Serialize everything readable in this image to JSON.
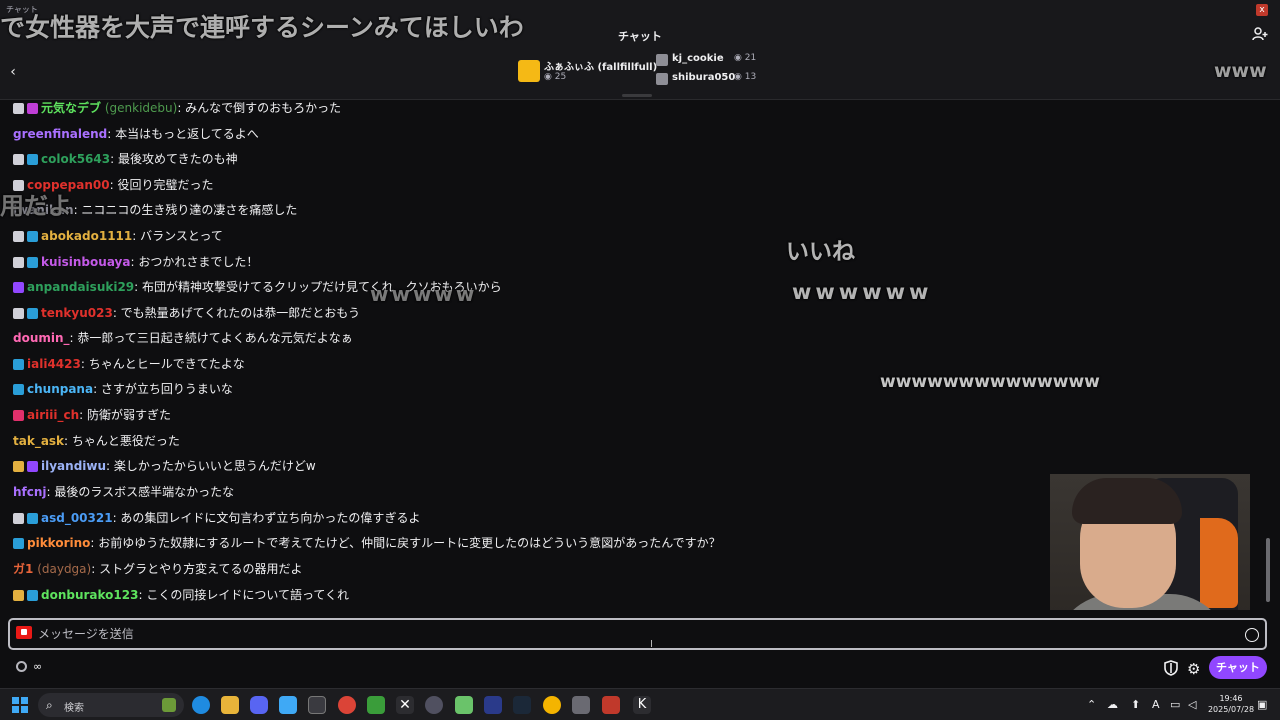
{
  "window": {
    "title": "チャット",
    "close_label": "x"
  },
  "header": {
    "title": "チャット",
    "host": {
      "name": "ふぁふぃふ (fallfillfull)",
      "views": "25"
    },
    "guests": [
      {
        "name": "kj_cookie",
        "views": "21"
      },
      {
        "name": "shibura050",
        "views": "13"
      }
    ]
  },
  "overlay_comments": {
    "top": "で女性器を大声で連呼するシーンみてほしいわ",
    "w1": "www",
    "yo": "用だよ",
    "iine": "いいね",
    "w2": "wwwwww",
    "w3": "wwwww",
    "w4": "wwwwwwwwwwwwww"
  },
  "messages": [
    {
      "user": "元気なデブ",
      "handle": "(genkidebu)",
      "text": ": みんなで倒すのおもろかった",
      "color": "#5ee35e",
      "badges": [
        "b-sub",
        "b-gift"
      ]
    },
    {
      "user": "greenfinalend",
      "handle": "",
      "text": ": 本当はもっと返してるよへ",
      "color": "#a970ff",
      "badges": []
    },
    {
      "user": "colok5643",
      "handle": "",
      "text": ": 最後攻めてきたのも神",
      "color": "#2ea05c",
      "badges": [
        "b-sub",
        "b-prime"
      ]
    },
    {
      "user": "coppepan00",
      "handle": "",
      "text": ": 役回り完璧だった",
      "color": "#e0312c",
      "badges": [
        "b-sub"
      ]
    },
    {
      "user": "iwanikan",
      "handle": "",
      "text": ": ニコニコの生き残り達の凄さを痛感した",
      "color": "#8c8c96",
      "badges": []
    },
    {
      "user": "abokado1111",
      "handle": "",
      "text": ": バランスとって",
      "color": "#e3b040",
      "badges": [
        "b-sub",
        "b-prime"
      ]
    },
    {
      "user": "kuisinbouaya",
      "handle": "",
      "text": ": おつかれさまでした！",
      "color": "#c45ae8",
      "badges": [
        "b-sub",
        "b-prime"
      ]
    },
    {
      "user": "anpandaisuki29",
      "handle": "",
      "text": ": 布団が精神攻撃受けてるクリップだけ見てくれ　クソおもろいから",
      "color": "#2ea05c",
      "badges": [
        "b-partner"
      ]
    },
    {
      "user": "tenkyu023",
      "handle": "",
      "text": ": でも熱量あげてくれたのは恭一郎だとおもう",
      "color": "#e0312c",
      "badges": [
        "b-sub",
        "b-prime"
      ]
    },
    {
      "user": "doumin_",
      "handle": "",
      "text": ": 恭一郎って三日起き続けてよくあんな元気だよなぁ",
      "color": "#ff69b4",
      "badges": []
    },
    {
      "user": "iali4423",
      "handle": "",
      "text": ": ちゃんとヒールできてたよな",
      "color": "#e0312c",
      "badges": [
        "b-prime"
      ]
    },
    {
      "user": "chunpana",
      "handle": "",
      "text": ": さすが立ち回りうまいな",
      "color": "#4bb5f5",
      "badges": [
        "b-prime"
      ]
    },
    {
      "user": "airiii_ch",
      "handle": "",
      "text": ": 防衛が弱すぎた",
      "color": "#e0312c",
      "badges": [
        "b-pink"
      ]
    },
    {
      "user": "tak_ask",
      "handle": "",
      "text": ": ちゃんと悪役だった",
      "color": "#e3b040",
      "badges": []
    },
    {
      "user": "ilyandiwu",
      "handle": "",
      "text": ": 楽しかったからいいと思うんだけどw",
      "color": "#9bb2f5",
      "badges": [
        "b-gold",
        "b-partner"
      ]
    },
    {
      "user": "hfcnj",
      "handle": "",
      "text": ": 最後のラスボス感半端なかったな",
      "color": "#a970ff",
      "badges": []
    },
    {
      "user": "asd_00321",
      "handle": "",
      "text": ": あの集団レイドに文句言わず立ち向かったの偉すぎるよ",
      "color": "#4b9cf5",
      "badges": [
        "b-sub",
        "b-prime"
      ]
    },
    {
      "user": "pikkorino",
      "handle": "",
      "text": ": お前ゆゆうた奴隷にするルートで考えてたけど、仲間に戻すルートに変更したのはどういう意図があったんですか？",
      "color": "#ff8c3a",
      "badges": [
        "b-prime"
      ]
    },
    {
      "user": "ガ1",
      "handle": "(daydga)",
      "text": ": ストグラとやり方変えてるの器用だよ",
      "color": "#e8643a",
      "badges": []
    },
    {
      "user": "donburako123",
      "handle": "",
      "text": ": こくの同接レイドについて語ってくれ",
      "color": "#5ee35e",
      "badges": [
        "b-gold",
        "b-prime"
      ]
    }
  ],
  "input": {
    "placeholder": "メッセージを送信",
    "value": ""
  },
  "footer": {
    "points": "∞",
    "chat_button": "チャット"
  },
  "taskbar": {
    "search_label": "検索",
    "time": "19:46",
    "date": "2025/07/28",
    "ime": "A"
  }
}
